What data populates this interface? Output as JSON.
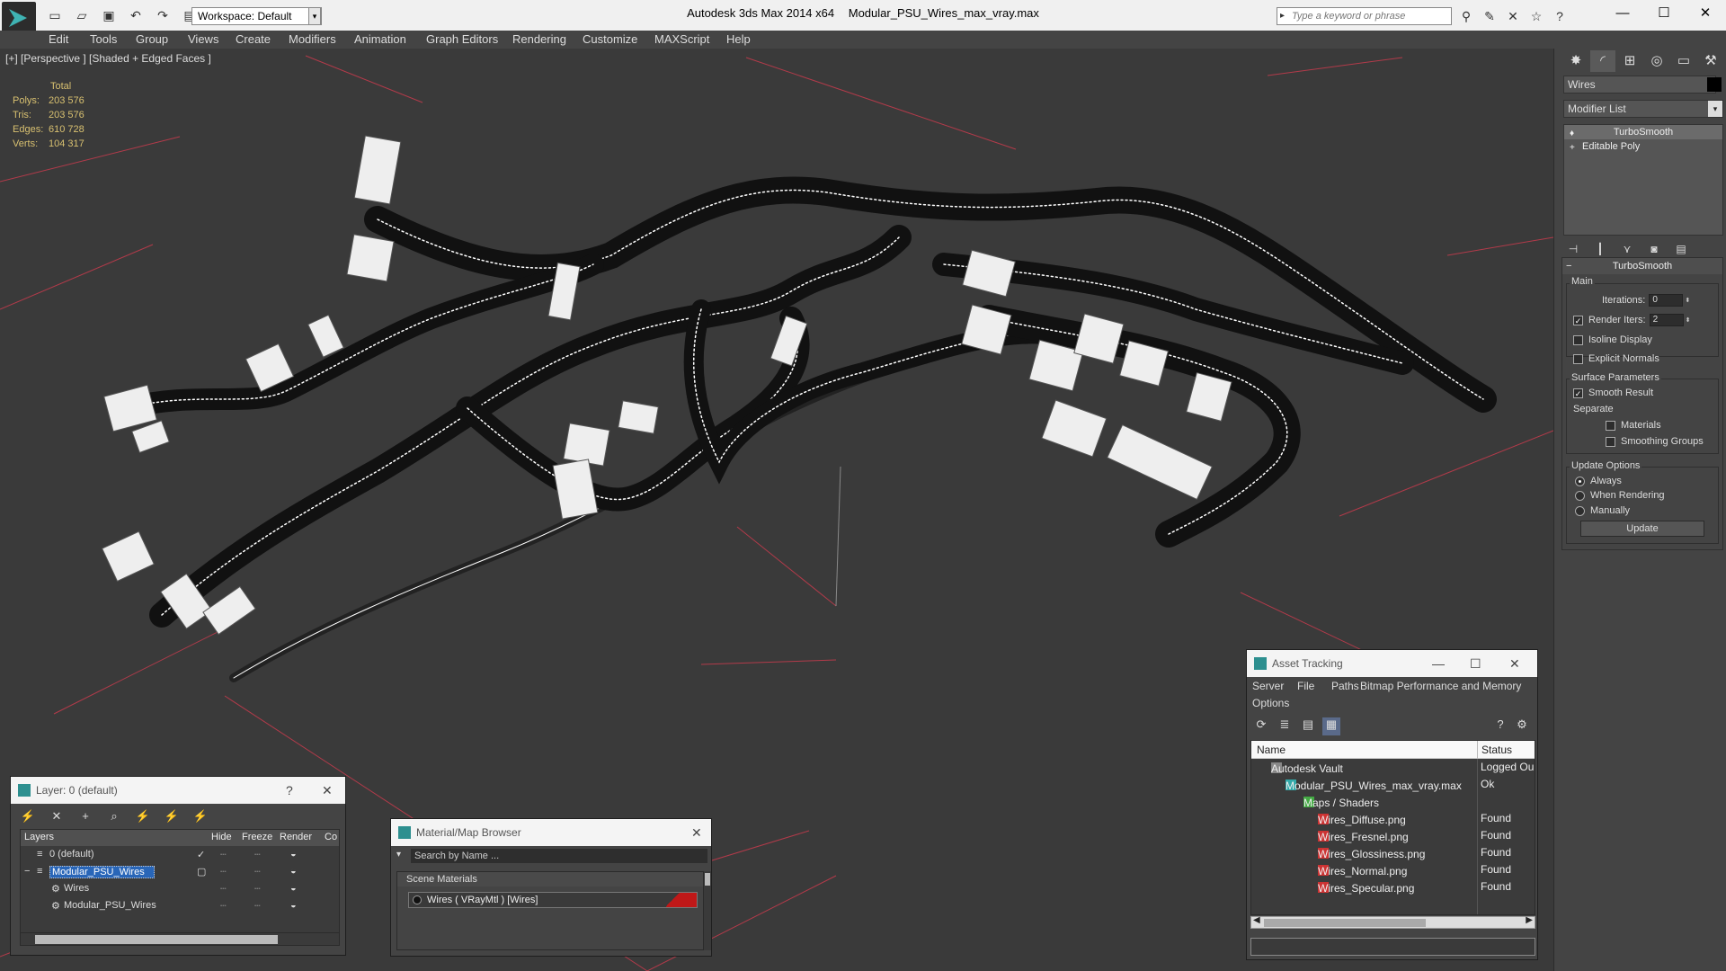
{
  "titlebar": {
    "workspace": "Workspace: Default",
    "app": "Autodesk 3ds Max  2014 x64",
    "file": "Modular_PSU_Wires_max_vray.max",
    "search_placeholder": "Type a keyword or phrase"
  },
  "menu": [
    "Edit",
    "Tools",
    "Group",
    "Views",
    "Create",
    "Modifiers",
    "Animation",
    "Graph Editors",
    "Rendering",
    "Customize",
    "MAXScript",
    "Help"
  ],
  "viewport": {
    "label": "[+] [Perspective ] [Shaded + Edged Faces ]",
    "stats": {
      "header": "Total",
      "rows": [
        {
          "k": "Polys:",
          "v": "203 576"
        },
        {
          "k": "Tris:",
          "v": "203 576"
        },
        {
          "k": "Edges:",
          "v": "610 728"
        },
        {
          "k": "Verts:",
          "v": "104 317"
        }
      ]
    }
  },
  "command_panel": {
    "object_name": "Wires",
    "object_color": "#000000",
    "modifier_list": "Modifier List",
    "stack": [
      "TurboSmooth",
      "Editable Poly"
    ],
    "turbosmooth": {
      "title": "TurboSmooth",
      "main_label": "Main",
      "iterations_label": "Iterations:",
      "iterations": "0",
      "render_iters_label": "Render Iters:",
      "render_iters": "2",
      "isoline": "Isoline Display",
      "explicit_normals": "Explicit Normals",
      "surface_label": "Surface Parameters",
      "smooth_result": "Smooth Result",
      "separate_label": "Separate",
      "materials": "Materials",
      "smoothing_groups": "Smoothing Groups",
      "update_label": "Update Options",
      "always": "Always",
      "when_rendering": "When Rendering",
      "manually": "Manually",
      "update_button": "Update"
    }
  },
  "layers": {
    "title": "Layer: 0 (default)",
    "cols": [
      "Layers",
      "Hide",
      "Freeze",
      "Render",
      "Co"
    ],
    "rows": [
      "0 (default)",
      "Modular_PSU_Wires",
      "Wires",
      "Modular_PSU_Wires"
    ]
  },
  "material_browser": {
    "title": "Material/Map Browser",
    "search_placeholder": "Search by Name ...",
    "section": "Scene Materials",
    "item": "Wires  ( VRayMtl )  [Wires]"
  },
  "asset_tracking": {
    "title": "Asset Tracking",
    "menu": [
      "Server",
      "File",
      "Paths",
      "Bitmap Performance and Memory",
      "Options"
    ],
    "col_name": "Name",
    "col_status": "Status",
    "rows": [
      {
        "name": "Autodesk Vault",
        "status": "Logged Ou"
      },
      {
        "name": "Modular_PSU_Wires_max_vray.max",
        "status": "Ok"
      },
      {
        "name": "Maps / Shaders",
        "status": ""
      },
      {
        "name": "Wires_Diffuse.png",
        "status": "Found"
      },
      {
        "name": "Wires_Fresnel.png",
        "status": "Found"
      },
      {
        "name": "Wires_Glossiness.png",
        "status": "Found"
      },
      {
        "name": "Wires_Normal.png",
        "status": "Found"
      },
      {
        "name": "Wires_Specular.png",
        "status": "Found"
      }
    ]
  },
  "colors": {
    "viewport_bg": "#3a3a3a",
    "grid_red": "#c03a4a",
    "stats_text": "#d8c070",
    "selection": "#2966b8"
  }
}
